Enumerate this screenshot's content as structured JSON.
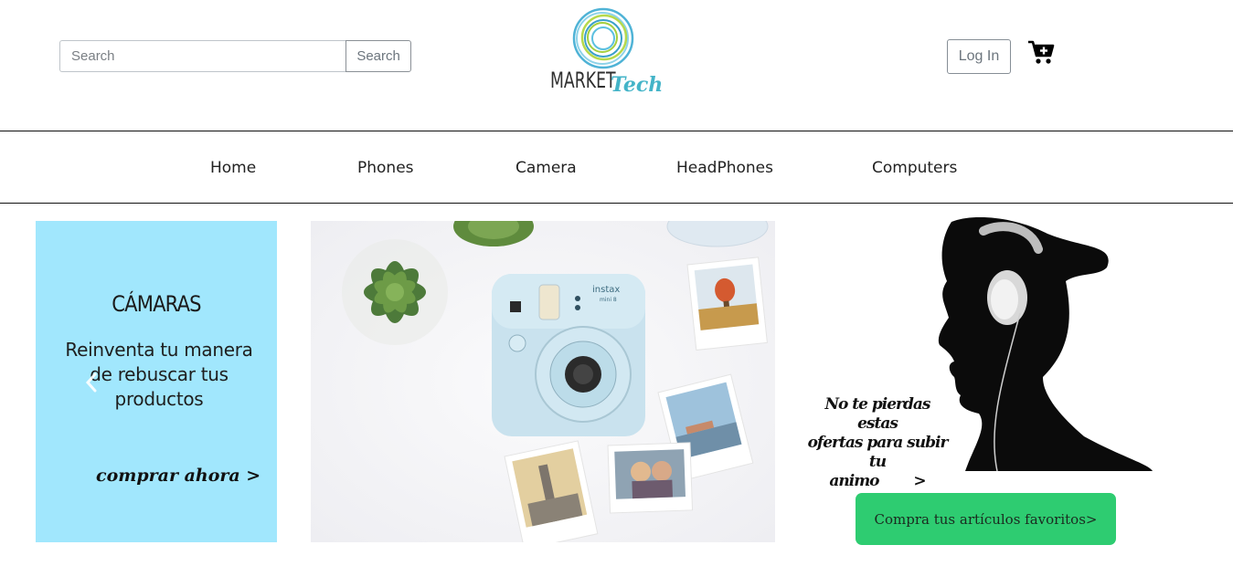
{
  "header": {
    "search_placeholder": "Search",
    "search_button": "Search",
    "logo_word_1": "MARKET",
    "logo_word_2": "Tech",
    "login_button": "Log In",
    "cart_icon": "cart-plus-icon"
  },
  "nav": {
    "items": [
      {
        "label": "Home"
      },
      {
        "label": "Phones"
      },
      {
        "label": "Camera"
      },
      {
        "label": "HeadPhones"
      },
      {
        "label": "Computers"
      }
    ]
  },
  "promo_cameras": {
    "title": "CÁMARAS",
    "text_line1": "Reinventa tu manera",
    "text_line2": "de rebuscar tus",
    "text_line3": "productos",
    "cta": "comprar ahora  >",
    "background": "#a1e7fd",
    "prev_icon": "chevron-left-icon"
  },
  "photo": {
    "camera_brand": "instax",
    "camera_model": "mini 8"
  },
  "headphones_promo": {
    "caption_line1": "No te pierdas estas",
    "caption_line2": "ofertas para subir tu",
    "caption_line3": "animo",
    "caption_arrow": ">"
  },
  "favorites_button": "Compra tus artículos favoritos>",
  "colors": {
    "accent_green": "#2ecc71",
    "promo_blue": "#a1e7fd",
    "logo_teal": "#44b4c8"
  }
}
